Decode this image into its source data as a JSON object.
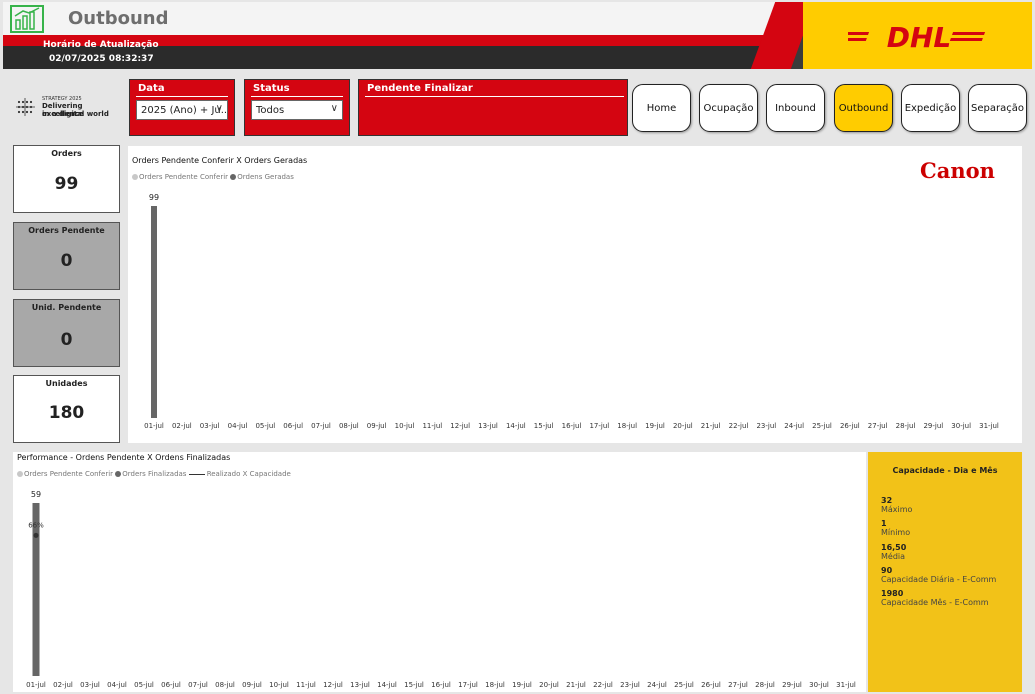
{
  "header": {
    "title": "Outbound",
    "update_label": "Horário de Atualização",
    "update_time": "02/07/2025 08:32:37",
    "logo_text": "DHL"
  },
  "strategy": {
    "line1": "STRATEGY 2025",
    "line2": "Delivering excellence",
    "line3": "in a digital world"
  },
  "filters": {
    "data": {
      "title": "Data",
      "value": "2025 (Ano) + Ju..."
    },
    "status": {
      "title": "Status",
      "value": "Todos"
    },
    "pendente": {
      "title": "Pendente Finalizar"
    }
  },
  "nav": [
    "Home",
    "Ocupação",
    "Inbound",
    "Outbound",
    "Expedição",
    "Separação"
  ],
  "nav_active": "Outbound",
  "kpis": {
    "orders": {
      "label": "Orders",
      "value": "99"
    },
    "orders_pendente": {
      "label": "Orders Pendente",
      "value": "0"
    },
    "unid_pendente": {
      "label": "Unid. Pendente",
      "value": "0"
    },
    "unidades": {
      "label": "Unidades",
      "value": "180"
    }
  },
  "canon_logo": "Canon",
  "colors": {
    "dhl_red": "#d40511",
    "dhl_yellow": "#ffcc00",
    "bar": "#666666",
    "capacity_bg": "#f2c218"
  },
  "chart_data": [
    {
      "type": "bar",
      "title": "Orders Pendente Conferir X Orders Geradas",
      "legend": [
        "Orders Pendente Conferir",
        "Ordens Geradas"
      ],
      "legend_colors": [
        "#c8c8c8",
        "#666666"
      ],
      "categories": [
        "01-jul",
        "02-jul",
        "03-jul",
        "04-jul",
        "05-jul",
        "06-jul",
        "07-jul",
        "08-jul",
        "09-jul",
        "10-jul",
        "11-jul",
        "12-jul",
        "13-jul",
        "14-jul",
        "15-jul",
        "16-jul",
        "17-jul",
        "18-jul",
        "19-jul",
        "20-jul",
        "21-jul",
        "22-jul",
        "23-jul",
        "24-jul",
        "25-jul",
        "26-jul",
        "27-jul",
        "28-jul",
        "29-jul",
        "30-jul",
        "31-jul"
      ],
      "series": [
        {
          "name": "Ordens Geradas",
          "values": [
            99
          ]
        }
      ],
      "data_labels": [
        "99"
      ],
      "ylim": [
        0,
        99
      ]
    },
    {
      "type": "bar",
      "title": "Performance - Ordens Pendente X Ordens Finalizadas",
      "legend": [
        "Orders Pendente Conferir",
        "Orders Finalizadas",
        "Realizado X Capacidade"
      ],
      "legend_colors": [
        "#c8c8c8",
        "#666666",
        "#333333"
      ],
      "categories": [
        "01-jul",
        "02-jul",
        "03-jul",
        "04-jul",
        "05-jul",
        "06-jul",
        "07-jul",
        "08-jul",
        "09-jul",
        "10-jul",
        "11-jul",
        "12-jul",
        "13-jul",
        "14-jul",
        "15-jul",
        "16-jul",
        "17-jul",
        "18-jul",
        "19-jul",
        "20-jul",
        "21-jul",
        "22-jul",
        "23-jul",
        "24-jul",
        "25-jul",
        "26-jul",
        "27-jul",
        "28-jul",
        "29-jul",
        "30-jul",
        "31-jul"
      ],
      "series": [
        {
          "name": "Orders Finalizadas",
          "values": [
            59
          ]
        },
        {
          "name": "Realizado X Capacidade",
          "values": [
            0.66
          ]
        }
      ],
      "data_labels": [
        "59",
        "66%"
      ],
      "ylim": [
        0,
        59
      ]
    }
  ],
  "capacity": {
    "title": "Capacidade - Dia e Mês",
    "items": [
      {
        "value": "32",
        "label": "Máximo"
      },
      {
        "value": "1",
        "label": "Mínimo"
      },
      {
        "value": "16,50",
        "label": "Média"
      },
      {
        "value": "90",
        "label": "Capacidade Diária - E-Comm"
      },
      {
        "value": "1980",
        "label": "Capacidade Mês - E-Comm"
      }
    ]
  }
}
